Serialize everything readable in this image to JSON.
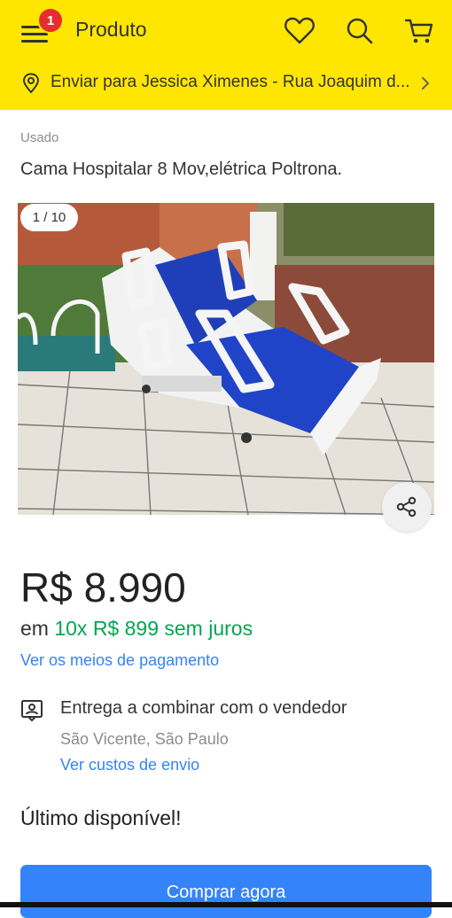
{
  "header": {
    "title": "Produto",
    "notification_count": "1",
    "brand_color": "#ffe600",
    "icons": [
      "menu-icon",
      "heart-icon",
      "search-icon",
      "cart-icon"
    ]
  },
  "address": {
    "text": "Enviar para Jessica Ximenes - Rua Joaquim d..."
  },
  "product": {
    "condition": "Usado",
    "title": "Cama Hospitalar 8 Mov,elétrica Poltrona.",
    "image_counter": "1 / 10",
    "price": "R$ 8.990",
    "installment_prefix": "em",
    "installment_highlight": "10x R$ 899 sem juros",
    "payment_link": "Ver os meios de pagamento"
  },
  "shipping": {
    "title": "Entrega a combinar com o vendedor",
    "location": "São Vicente, São Paulo",
    "link": "Ver custos de envio"
  },
  "stock": {
    "label": "Último disponível!"
  },
  "actions": {
    "buy_label": "Comprar agora",
    "accent_color": "#3483fa",
    "success_color": "#00a650"
  }
}
